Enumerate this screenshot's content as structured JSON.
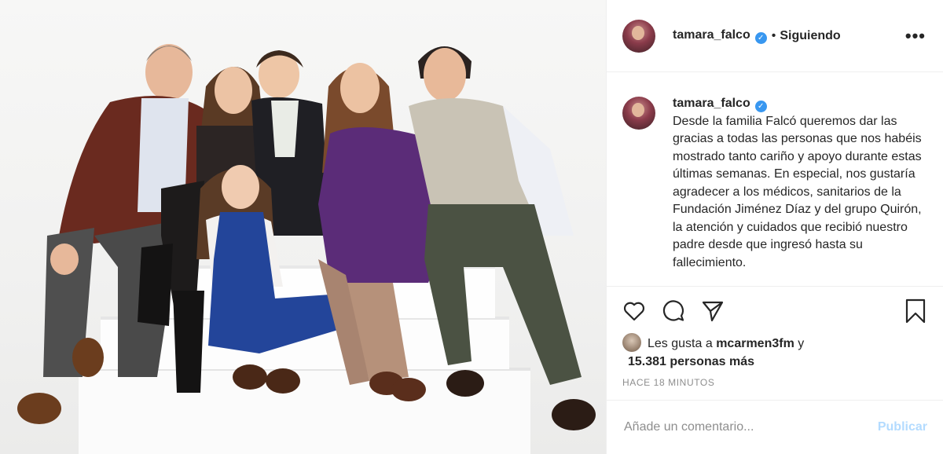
{
  "header": {
    "username": "tamara_falco",
    "separator": "•",
    "follow_status": "Siguiendo",
    "more_label": "•••",
    "verified_mark": "✓"
  },
  "caption": {
    "username": "tamara_falco",
    "text": "Desde la familia Falcó queremos dar las gracias a todas las personas que nos habéis mostrado tanto cariño y apoyo durante estas últimas semanas. En especial, nos gustaría agradecer a los médicos, sanitarios de la Fundación Jiménez Díaz y del grupo Quirón, la atención y cuidados que recibió nuestro padre desde que ingresó hasta su fallecimiento."
  },
  "actions": {
    "icons": [
      "heart-icon",
      "comment-icon",
      "share-icon",
      "bookmark-icon"
    ]
  },
  "likes": {
    "prefix": "Les gusta a",
    "user": "mcarmen3fm",
    "joiner": "y",
    "others": "15.381 personas más"
  },
  "timestamp": "HACE 18 MINUTOS",
  "comment": {
    "placeholder": "Añade un comentario...",
    "publish_label": "Publicar"
  },
  "colors": {
    "verified": "#3897f0",
    "publish_disabled": "#b3dbff",
    "muted": "#8e8e8e",
    "text": "#262626"
  }
}
